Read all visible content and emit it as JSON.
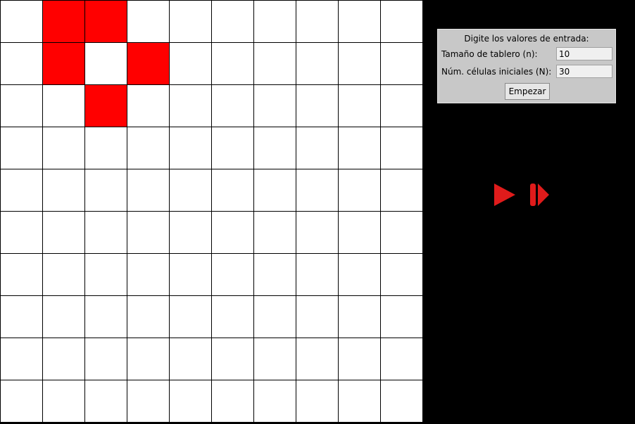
{
  "board": {
    "size": 10,
    "alive_cells": [
      [
        0,
        1
      ],
      [
        0,
        2
      ],
      [
        1,
        1
      ],
      [
        1,
        3
      ],
      [
        2,
        2
      ]
    ]
  },
  "panel": {
    "title": "Digite los valores de entrada:",
    "board_size_label": "Tamaño de tablero (n):",
    "board_size_value": "10",
    "initial_cells_label": "Núm. células iniciales (N):",
    "initial_cells_value": "30",
    "start_button_label": "Empezar"
  },
  "controls": {
    "play_icon": "play-icon",
    "step_icon": "step-forward-icon"
  },
  "colors": {
    "alive": "#ff0000",
    "dead": "#ffffff",
    "background": "#000000",
    "control": "#e01b1b"
  }
}
